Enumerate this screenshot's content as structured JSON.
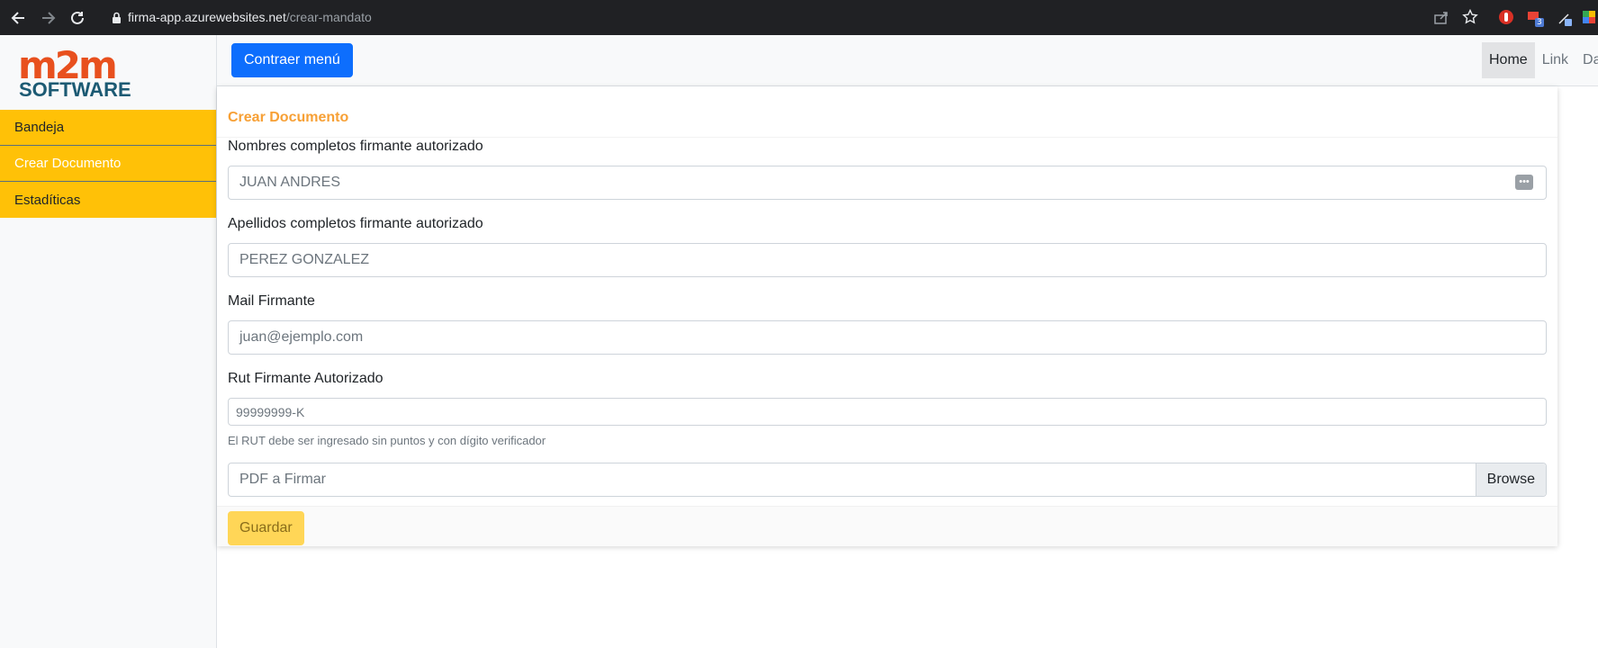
{
  "browser": {
    "url_host": "firma-app.azurewebsites.net",
    "url_path": "/crear-mandato",
    "extension_badge": "3"
  },
  "sidebar": {
    "logo_top": "m2m",
    "logo_bottom": "SOFTWARE",
    "items": [
      {
        "label": "Bandeja"
      },
      {
        "label": "Crear Documento"
      },
      {
        "label": "Estadíticas"
      }
    ]
  },
  "topbar": {
    "toggle_label": "Contraer menú",
    "links": [
      "Home",
      "Link",
      "Da"
    ]
  },
  "form": {
    "title": "Crear Documento",
    "nombres_label": "Nombres completos firmante autorizado",
    "nombres_value": "JUAN ANDRES",
    "apellidos_label": "Apellidos completos firmante autorizado",
    "apellidos_value": "PEREZ GONZALEZ",
    "mail_label": "Mail Firmante",
    "mail_placeholder": "juan@ejemplo.com",
    "rut_label": "Rut Firmante Autorizado",
    "rut_placeholder": "99999999-K",
    "rut_help": "El RUT debe ser ingresado sin puntos y con dígito verificador",
    "pdf_label": "PDF a Firmar",
    "browse_label": "Browse",
    "save_label": "Guardar"
  },
  "colors": {
    "accent_blue": "#0d6efd",
    "sidebar_yellow": "#ffc107",
    "title_orange": "#f7a035",
    "logo_orange": "#e8501e",
    "logo_teal": "#1c5a73"
  }
}
